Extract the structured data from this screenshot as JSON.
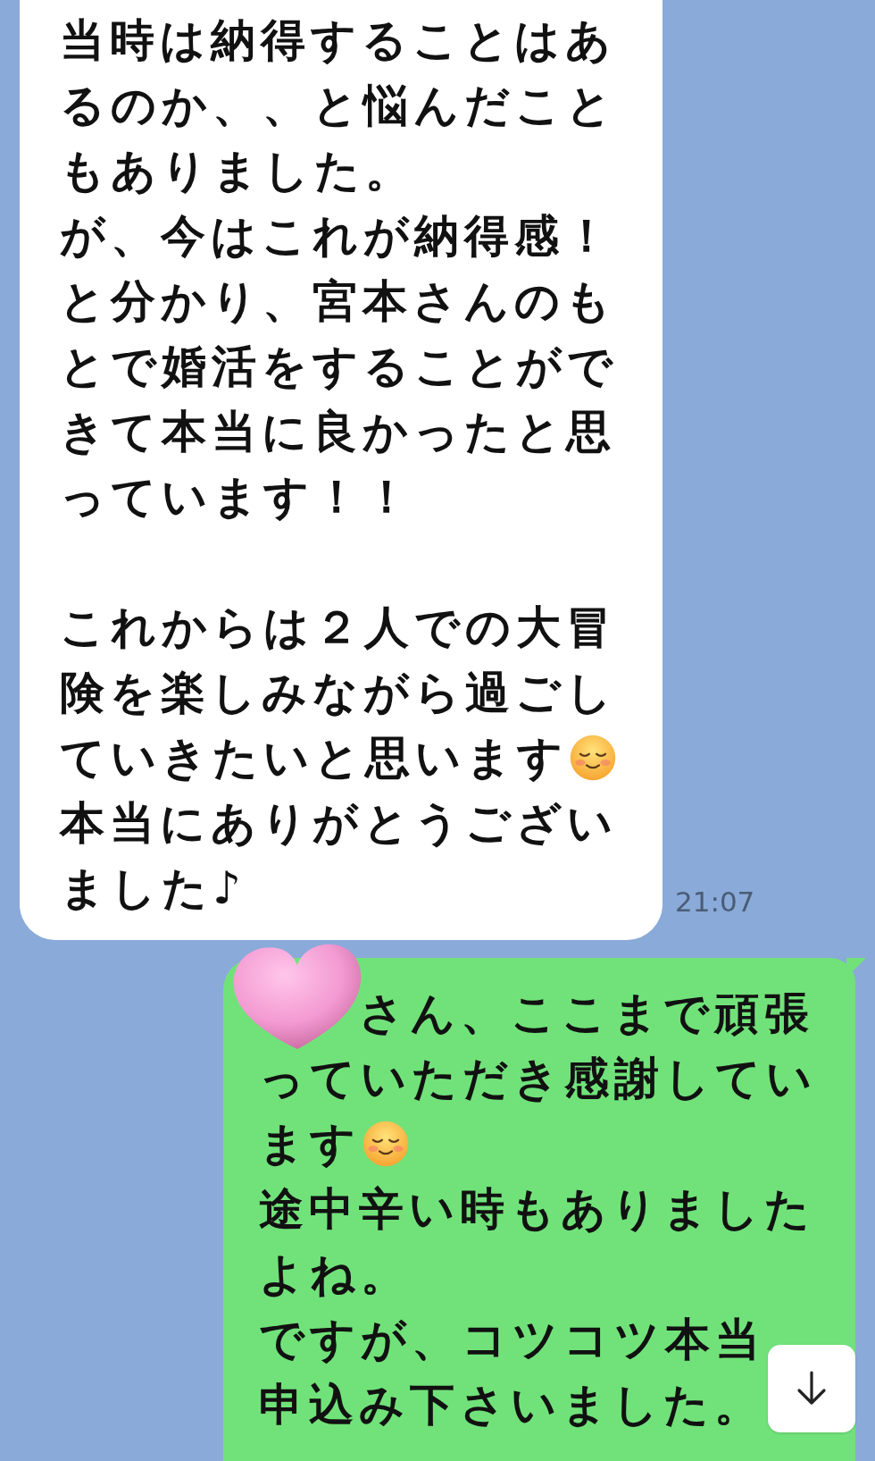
{
  "messages": [
    {
      "kind": "received",
      "time": "21:07",
      "lines": [
        {
          "kind": "text",
          "text": "当時は納得することはあ"
        },
        {
          "kind": "text",
          "text": "るのか、、と悩んだこと"
        },
        {
          "kind": "text",
          "text": "もありました。"
        },
        {
          "kind": "text",
          "text": "が、今はこれが納得感！"
        },
        {
          "kind": "text",
          "text": "と分かり、宮本さんのも"
        },
        {
          "kind": "text",
          "text": "とで婚活をすることがで"
        },
        {
          "kind": "text",
          "text": "きて本当に良かったと思"
        },
        {
          "kind": "text",
          "text": "っています！！"
        },
        {
          "kind": "blank"
        },
        {
          "kind": "text",
          "text": "これからは２人での大冒"
        },
        {
          "kind": "text",
          "text": "険を楽しみながら過ごし"
        },
        {
          "kind": "emoji",
          "text": "ていきたいと思います"
        },
        {
          "kind": "text",
          "text": "本当にありがとうござい"
        },
        {
          "kind": "text",
          "text": "ました♪"
        }
      ]
    },
    {
      "kind": "sent",
      "stickers": [
        {
          "kind": "heart"
        }
      ],
      "lines": [
        {
          "kind": "text",
          "text": "さん、ここまで頑張"
        },
        {
          "kind": "text",
          "text": "っていただき感謝してい"
        },
        {
          "kind": "emoji",
          "text": "ます"
        },
        {
          "kind": "text",
          "text": "途中辛い時もありました"
        },
        {
          "kind": "text",
          "text": "よね。"
        },
        {
          "kind": "text",
          "text": "ですが、コツコツ本当"
        },
        {
          "kind": "text",
          "text": "申込み下さいました。"
        }
      ]
    }
  ],
  "scroll_to_bottom_button": true
}
